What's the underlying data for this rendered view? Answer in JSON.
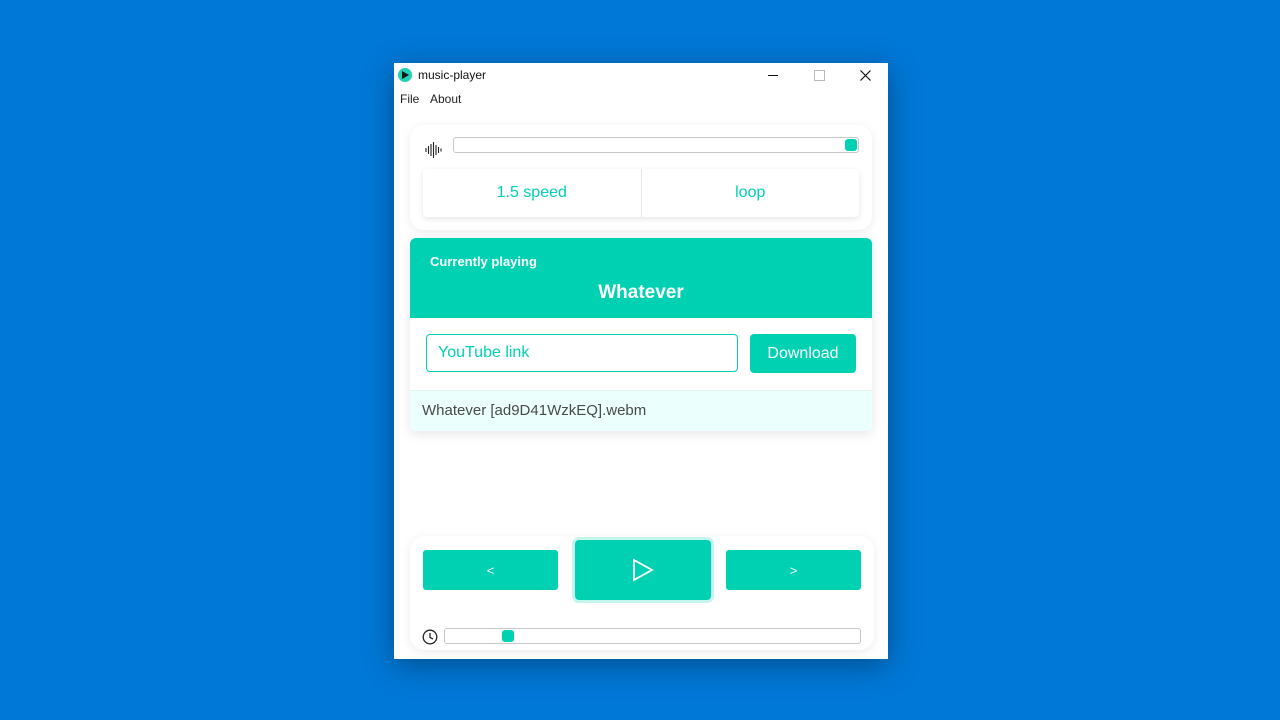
{
  "window": {
    "title": "music-player",
    "icon": "play-circle-icon",
    "controls": {
      "minimize": "minimize-icon",
      "maximize": "maximize-icon",
      "close": "close-icon"
    }
  },
  "menu": {
    "items": [
      "File",
      "About"
    ]
  },
  "settings": {
    "volume_icon": "waveform-icon",
    "volume_level": 1.0,
    "speed_label": "1.5 speed",
    "loop_label": "loop"
  },
  "now_playing": {
    "label": "Currently playing",
    "title": "Whatever"
  },
  "download": {
    "input_placeholder": "YouTube link",
    "input_value": "",
    "button_label": "Download"
  },
  "files": [
    {
      "name": "Whatever [ad9D41WzkEQ].webm"
    }
  ],
  "playback": {
    "prev_label": "<",
    "next_label": ">",
    "play_icon": "play-icon",
    "seek_icon": "clock-icon",
    "seek_position": 0.14
  },
  "colors": {
    "accent": "#00d1b2",
    "desktop": "#0078d7",
    "file_highlight": "#ebfffc"
  }
}
